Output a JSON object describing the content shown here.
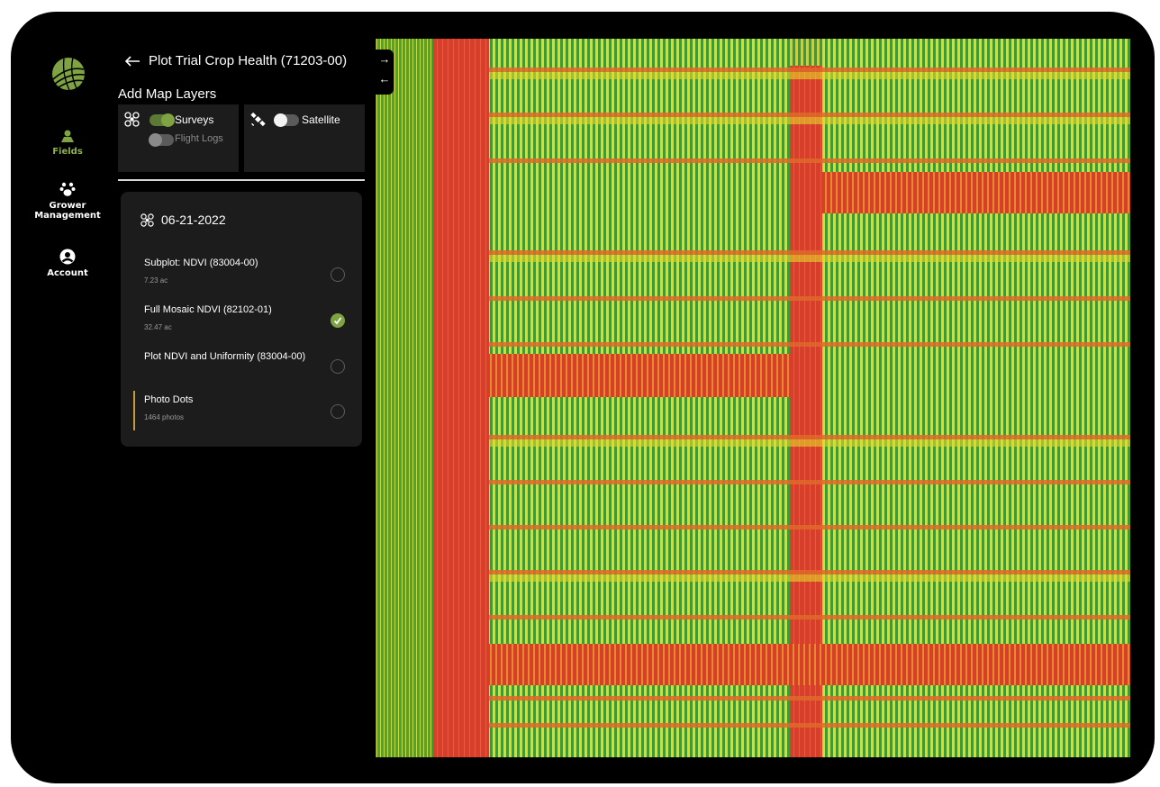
{
  "nav": {
    "fields_label": "Fields",
    "grower_label_1": "Grower",
    "grower_label_2": "Management",
    "account_label": "Account"
  },
  "panel": {
    "title": "Plot Trial Crop Health (71203-00)",
    "section_title": "Add Map Layers",
    "layers": {
      "surveys": {
        "label": "Surveys",
        "state": "on"
      },
      "flight_logs": {
        "label": "Flight Logs",
        "state": "off"
      },
      "satellite": {
        "label": "Satellite",
        "state": "off"
      }
    },
    "survey": {
      "date": "06-21-2022",
      "items": [
        {
          "name": "Subplot: NDVI (83004-00)",
          "sub": "7.23 ac",
          "checked": false
        },
        {
          "name": "Full Mosaic NDVI (82102-01)",
          "sub": "32.47 ac",
          "checked": true
        },
        {
          "name": "Plot NDVI and Uniformity (83004-00)",
          "sub": "",
          "checked": false
        },
        {
          "name": "Photo Dots",
          "sub": "1464 photos",
          "checked": false
        }
      ]
    }
  },
  "map": {
    "expand_arrow": "→",
    "collapse_arrow": "←",
    "ndvi_colors": {
      "high": "#3f9a36",
      "mid": "#d9dc2a",
      "low": "#d6402a"
    }
  }
}
